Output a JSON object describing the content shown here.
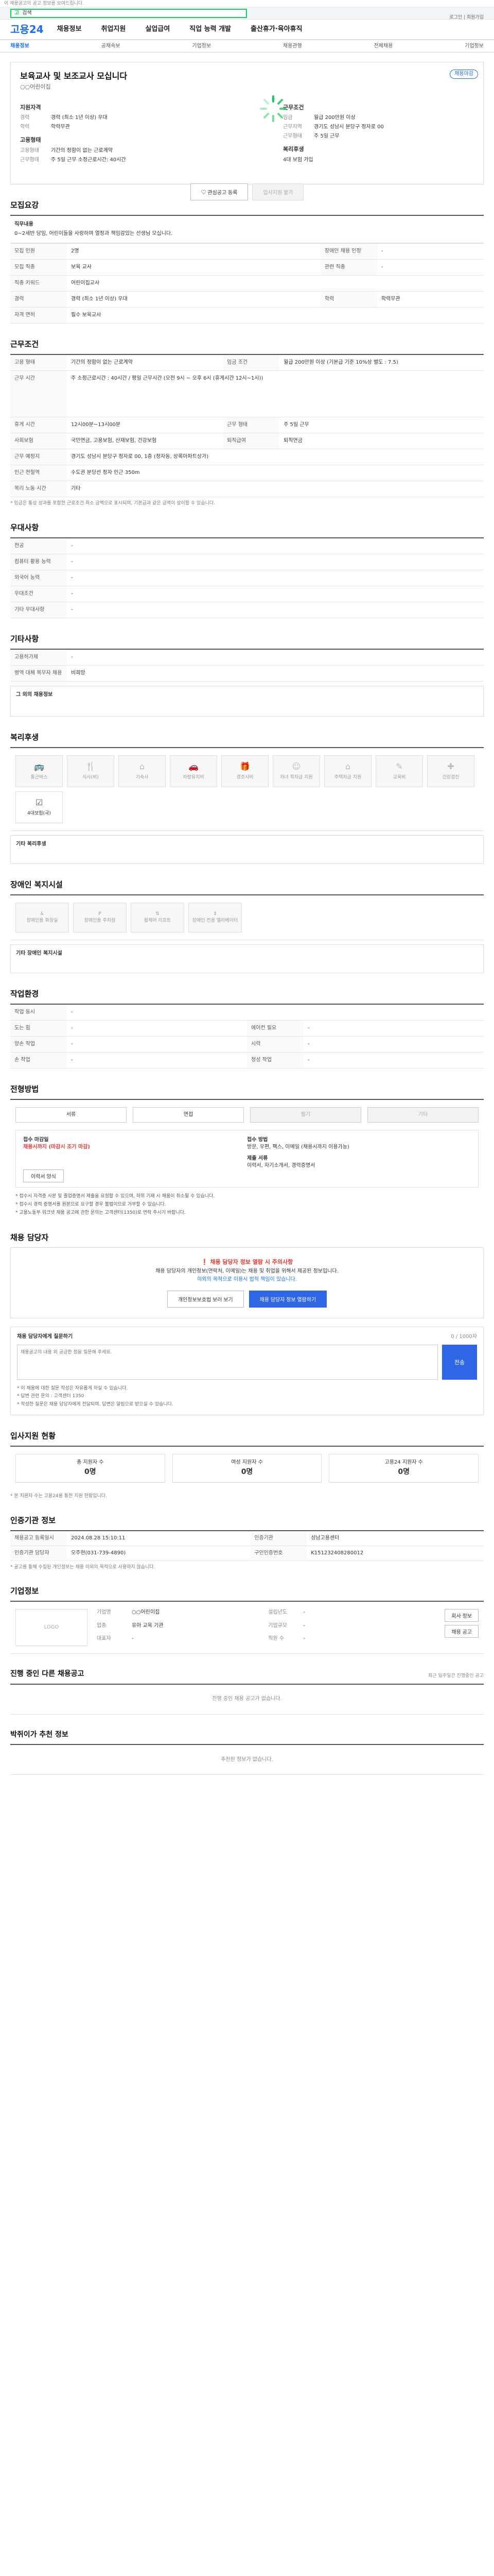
{
  "topbar": {
    "text": "이 채용공고의 공고 정보를 보여드립니다."
  },
  "search": {
    "logo": "고",
    "value": "검색"
  },
  "header": {
    "brand": "고용24",
    "nav": [
      "채용정보",
      "취업지원",
      "실업급여",
      "직업 능력 개발",
      "출산휴가·육아휴직"
    ],
    "util": "로그인 | 회원가입"
  },
  "lnb": {
    "items": [
      "채용정보",
      "공채속보",
      "기업정보",
      "채용관행",
      "전체채용",
      "기업정보"
    ]
  },
  "job": {
    "title": "보육교사 및 보조교사 모십니다",
    "badge": "채용마감",
    "company": "○○어린이집",
    "qual_title": "지원자격",
    "qual": [
      {
        "k": "경력",
        "v": "경력 (최소 1년 이상) 우대"
      },
      {
        "k": "학력",
        "v": "학력무관"
      }
    ],
    "work_title": "근무조건",
    "work": [
      {
        "k": "임금",
        "v": "월급 200만원 이상"
      },
      {
        "k": "근무지역",
        "v": "경기도 성남시 분당구 정자로 00"
      },
      {
        "k": "근무형태",
        "v": "주 5일 근무"
      }
    ],
    "emp_title": "고용형태",
    "emp": [
      {
        "k": "고용형태",
        "v": "기간의 정함이 없는 근로계약"
      },
      {
        "k": "근무형태",
        "v": "주 5일 근무 소정근로시간: 40시간"
      }
    ],
    "pref_title": "복리후생",
    "pref": "4대 보험 가입",
    "btn_save": "관심공고 등록",
    "btn_apply": "입사지원 불가"
  },
  "recruit": {
    "title": "모집요강",
    "task_label": "직무내용",
    "task": "0~2세반 담임, 어린이들을 사랑하며 열정과 책임감있는 선생님 모십니다.",
    "rows": [
      {
        "k1": "모집 인원",
        "v1": "2명",
        "k2": "장애인 채용 인정",
        "v2": "-"
      },
      {
        "k1": "모집 직종",
        "v1": "보육 교사",
        "k2": "관련 직종",
        "v2": "-"
      },
      {
        "k1": "직종 키워드",
        "v1": "어린이집교사",
        "k2": "",
        "v2": ""
      },
      {
        "k1": "경력",
        "v1": "경력 (최소 1년 이상) 우대",
        "k2": "학력",
        "v2": "학력무관"
      },
      {
        "k1": "자격 면허",
        "v1": "필수 보육교사",
        "k2": "",
        "v2": ""
      }
    ]
  },
  "condition": {
    "title": "근무조건",
    "rows": [
      {
        "k1": "고용 형태",
        "v1": "기간의 정함이 없는 근로계약",
        "k2": "임금 조건",
        "v2": "월급 200만원 이상 (기본급 기준 10%상 별도 : 7.5)"
      },
      {
        "k1": "근무 시간",
        "v1": "주 소정근로시간 : 40시간 / 평일 근무시간 (오전 9시 ~ 오후 6시 (휴게시간 12시~1시))",
        "k2": "",
        "v2": ""
      },
      {
        "k1": "휴게 시간",
        "v1": "12시00분~13시00분",
        "k2": "근무 형태",
        "v2": "주 5일 근무"
      },
      {
        "k1": "사회보험",
        "v1": "국민연금, 고용보험, 산재보험, 건강보험",
        "k2": "퇴직급여",
        "v2": "퇴직연금"
      },
      {
        "k1": "근무 예정지",
        "v1": "경기도 성남시 분당구 정자로 00, 1층 (정자동, 상록아파트상가)",
        "k2": "",
        "v2": ""
      },
      {
        "k1": "인근 전철역",
        "v1": "수도권 분당선 정자 인근 350m",
        "k2": "",
        "v2": ""
      },
      {
        "k1": "복리 노동 시간",
        "v1": "기타",
        "k2": "",
        "v2": ""
      }
    ],
    "note": "* 임금은 통상 성과를 포함한 근로조건 최소 금액으로 표시되며, 기본급과 같은 금액이 상이할 수 있습니다."
  },
  "pref_cond": {
    "title": "우대사항",
    "rows": [
      {
        "k": "전공",
        "v": "-"
      },
      {
        "k": "컴퓨터 활용 능력",
        "v": "-"
      },
      {
        "k": "외국어 능력",
        "v": "-"
      },
      {
        "k": "우대조건",
        "v": "-"
      },
      {
        "k": "기타 우대사항",
        "v": "-"
      }
    ]
  },
  "etc": {
    "title": "기타사항",
    "rows": [
      {
        "k": "고용허가제",
        "v": "-"
      },
      {
        "k": "병역 대체 복무자 채용",
        "v": "비희망"
      }
    ],
    "extra": "그 외의 채용정보"
  },
  "welfare": {
    "title": "복리후생",
    "tiles": [
      {
        "icon": "bus-icon",
        "label": "통근버스",
        "on": false
      },
      {
        "icon": "meal-icon",
        "label": "식사(비)",
        "on": false
      },
      {
        "icon": "house-icon",
        "label": "기숙사",
        "on": false
      },
      {
        "icon": "car-icon",
        "label": "차량유지비",
        "on": false
      },
      {
        "icon": "gift-icon",
        "label": "경조사비",
        "on": false
      },
      {
        "icon": "child-icon",
        "label": "자녀 학자금 지원",
        "on": false
      },
      {
        "icon": "baby-icon",
        "label": "주택자금 지원",
        "on": false
      },
      {
        "icon": "edu-icon",
        "label": "교육비",
        "on": false
      },
      {
        "icon": "health-icon",
        "label": "건강검진",
        "on": false
      },
      {
        "icon": "ticket-icon",
        "label": "4대보험(국)",
        "on": true
      }
    ],
    "other_label": "기타 복리후생"
  },
  "disabled": {
    "title": "장애인 복지시설",
    "tiles": [
      "장애인용 화장실",
      "장애인용 주차장",
      "휠체어 리프트",
      "장애인 전용 엘리베이터"
    ],
    "other_label": "기타 장애인 복지시설"
  },
  "env": {
    "title": "작업환경",
    "rows": [
      {
        "k1": "작업 동시",
        "v1": "-",
        "k2": "",
        "v2": ""
      },
      {
        "k1": "도는 힘",
        "v1": "-",
        "k2": "에어컨 필요",
        "v2": "-"
      },
      {
        "k1": "양손 작업",
        "v1": "-",
        "k2": "시력",
        "v2": "-"
      },
      {
        "k1": "손 작업",
        "v1": "-",
        "k2": "청성 작업",
        "v2": "-"
      }
    ]
  },
  "process": {
    "title": "전형방법",
    "steps": [
      {
        "label": "서류",
        "off": false
      },
      {
        "label": "면접",
        "off": false
      },
      {
        "label": "필기",
        "off": true
      },
      {
        "label": "기타",
        "off": true
      }
    ],
    "deadline_label": "접수 마감일",
    "deadline": "채용시까지 (마감시 조기 마감)",
    "method_label": "접수 방법",
    "method": "방문, 우편, 팩스, 이메일 (채용시까지 이용가능)",
    "docs_label": "제출 서류",
    "docs": "이력서, 자기소개서, 경력증명서",
    "print_btn": "이력서 양식",
    "warn": [
      "* 접수시 자격증 사본 및 졸업증명서 제출을 요청할 수 있으며, 허위 기재 시 채용이 취소될 수 있습니다.",
      "* 접수시 경력 증명서를 원본으로 요구할 경우 불법이므로 거부할 수 있습니다.",
      "* 고용노동부 워크넷 채용 공고에 관한 문의는 고객센터(1350)로 연락 주시기 바랍니다."
    ]
  },
  "notice": {
    "title": "채용 담당자",
    "t1": "채용 담당자 정보 열람 시 주의사항",
    "t2": "채용 담당자의 개인정보(연락처, 이메일)는 채용 및 취업을 위해서 제공된 정보입니다.",
    "t3": "이외의 목적으로 이용시 법적 책임이 있습니다.",
    "btn1": "개인정보보호법 보러 보기",
    "btn2": "채용 담당자 정보 열람하기"
  },
  "qa": {
    "title": "채용 담당자에게 질문하기",
    "count": "0 / 1000자",
    "placeholder": "채용공고의 내용 외 궁금한 점을 질문해 주세요.",
    "send": "전송",
    "tips": [
      "* 이 채용에 대한 질문 작성은 자유롭게 하실 수 있습니다.",
      "* 답변 관련 문의 : 고객센터 1350",
      "* 작성한 질문은 채용 담당자에게 전달되며, 답변은 알림으로 받으실 수 있습니다."
    ]
  },
  "status": {
    "title": "입사지원 현황",
    "boxes": [
      {
        "k": "총 지원자 수",
        "v": "0명"
      },
      {
        "k": "여성 지원자 수",
        "v": "0명"
      },
      {
        "k": "고용24 지원자 수",
        "v": "0명"
      }
    ],
    "note": "* 본 지원자 수는 고용24를 통한 지원 현황입니다."
  },
  "hr": {
    "title": "인증기관 정보",
    "rows": [
      {
        "k1": "채용공고 등록일시",
        "v1": "2024.08.28 15:10:11",
        "k2": "인증기관",
        "v2": "성남고용센터"
      },
      {
        "k1": "인증기관 담당자",
        "v1": "오주현(031-739-4890)",
        "k2": "구인인증번호",
        "v2": "K151232408280012"
      }
    ],
    "note": "* 공고를 통해 수집된 개인정보는 채용 이외의 목적으로 사용하지 않습니다."
  },
  "comp": {
    "title": "기업정보",
    "logo": "LOGO",
    "info": [
      {
        "k": "기업명",
        "v": "○○어린이집"
      },
      {
        "k": "업종",
        "v": "유아 교육 기관"
      },
      {
        "k": "대표자",
        "v": "-"
      },
      {
        "k": "설립년도",
        "v": "-"
      },
      {
        "k": "기업규모",
        "v": "-"
      },
      {
        "k": "직원 수",
        "v": "-"
      }
    ],
    "btn1": "회사 정보",
    "btn2": "채용 공고"
  },
  "others": {
    "title": "진행 중인 다른 채용공고",
    "right": "최근 일주일간 진행중인 공고",
    "empty": "진행 중인 채용 공고가 없습니다."
  },
  "recommend": {
    "title": "박쥐이가 추천 정보",
    "empty": "추천된 정보가 없습니다."
  }
}
